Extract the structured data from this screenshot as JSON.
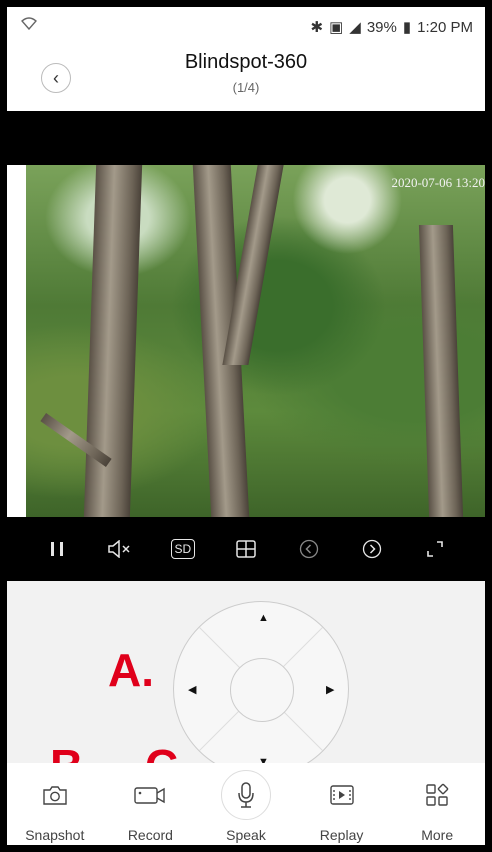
{
  "status_bar": {
    "wifi_icon": "wifi-icon",
    "right_text": "39%",
    "time": "1:20 PM"
  },
  "header": {
    "title": "Blindspot-360",
    "subtitle": "(1/4)"
  },
  "video": {
    "timestamp": "2020-07-06 13:20"
  },
  "controls": {
    "sd_label": "SD"
  },
  "annotations": {
    "a": "A.",
    "b": "B.",
    "c": "C."
  },
  "toolbar": {
    "snapshot": "Snapshot",
    "record": "Record",
    "speak": "Speak",
    "replay": "Replay",
    "more": "More"
  }
}
